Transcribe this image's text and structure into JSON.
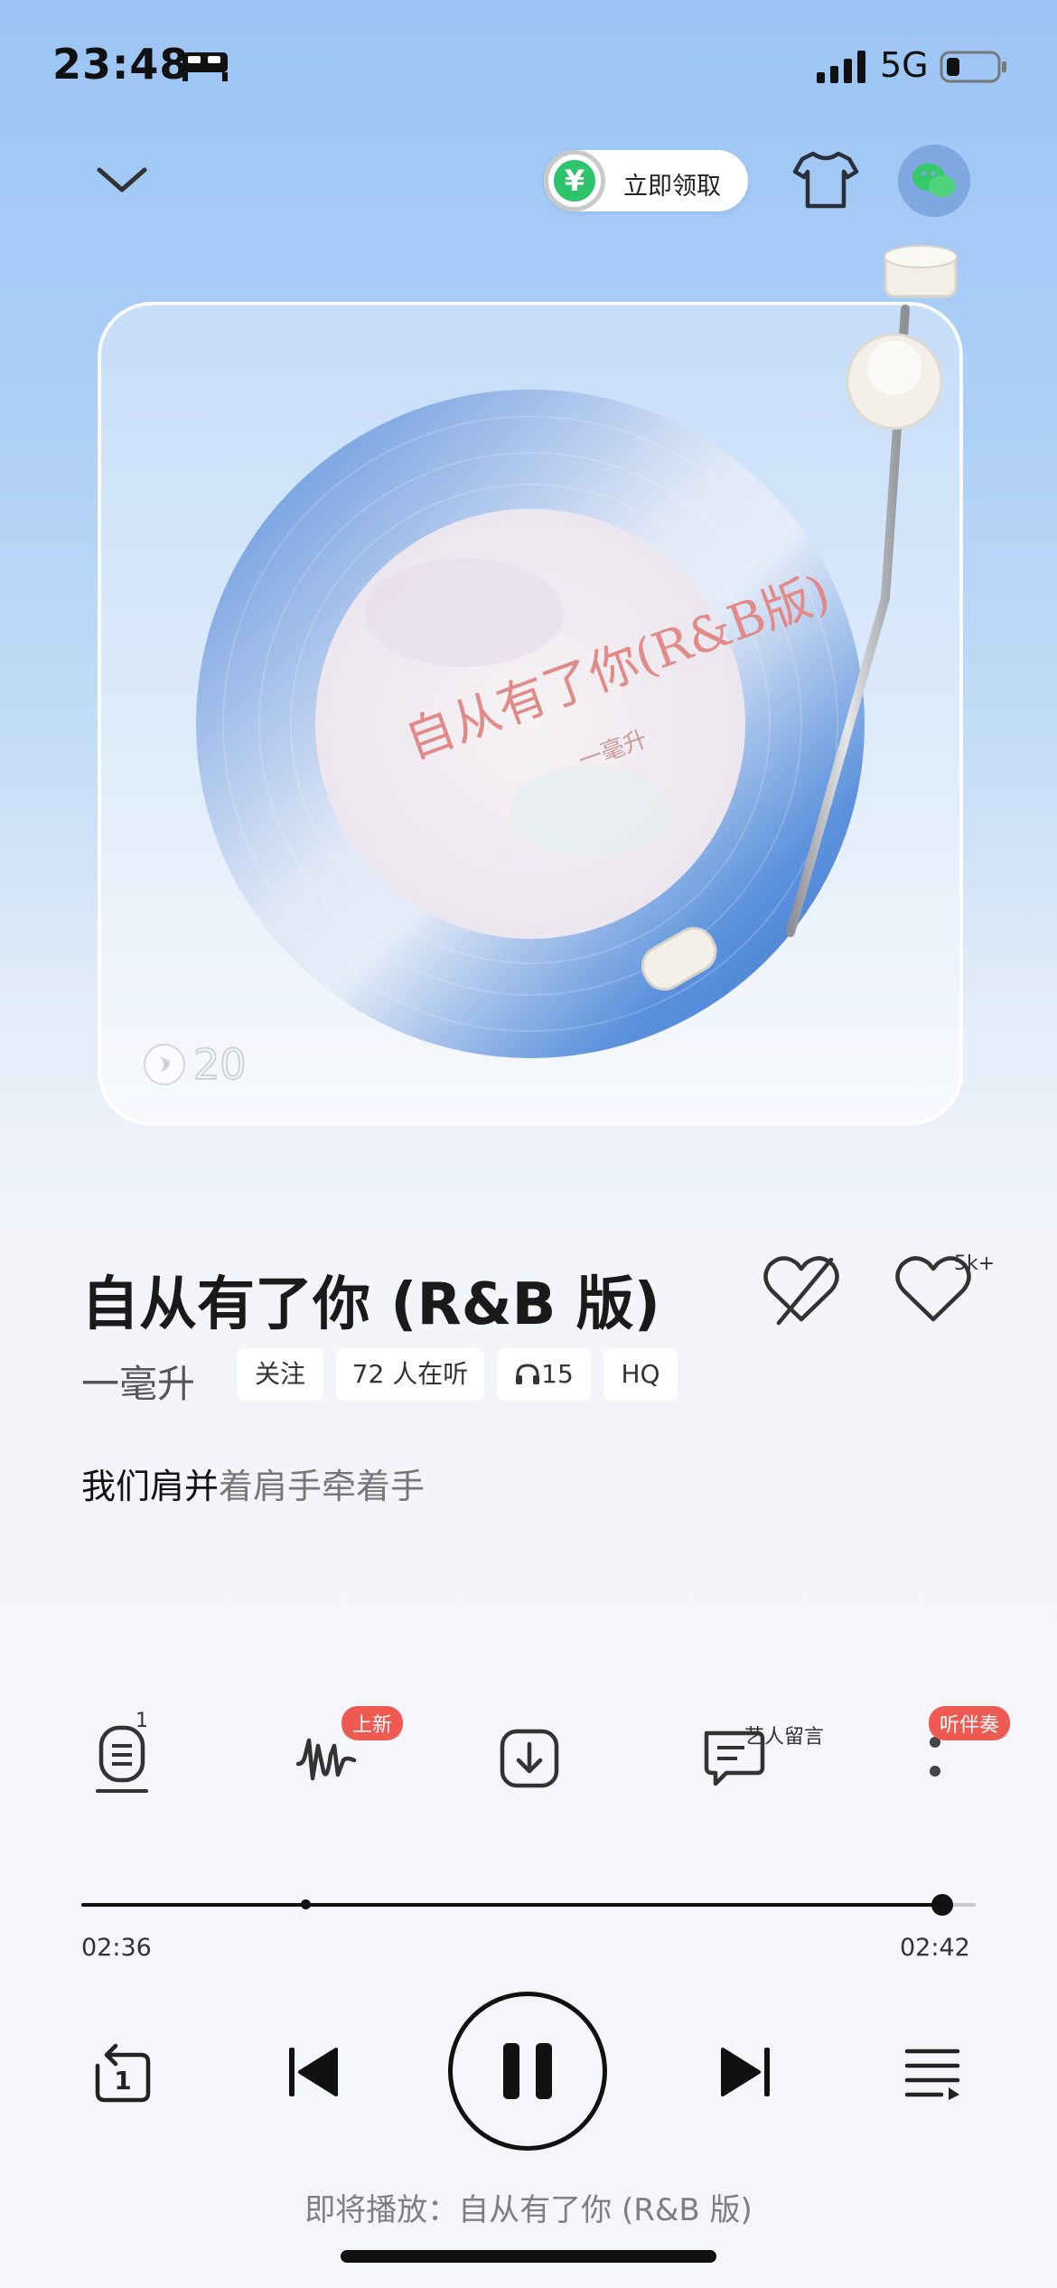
{
  "status_bar": {
    "time": "23:48",
    "network": "5G",
    "bed_icon": "bed-icon",
    "signal_icon": "signal-icon",
    "battery_icon": "battery-icon",
    "battery_level": 0.2
  },
  "top": {
    "claim_label": "立即领取",
    "coin_glyph": "¥",
    "collapse_icon": "chevron-down-icon",
    "theme_icon": "tshirt-icon",
    "share_icon": "wechat-icon"
  },
  "album_art": {
    "title_art": "自从有了你(R&B版)",
    "artist_art": "一毫升",
    "logo_text": "20"
  },
  "song": {
    "title": "自从有了你 (R&B 版)",
    "artist": "一毫升",
    "follow_label": "关注",
    "listeners_label": "72 人在听",
    "headphone_count": "15",
    "quality_label": "HQ",
    "like_count": "5k+"
  },
  "lyric": {
    "sung": "我们肩并",
    "unsung": "着肩手牵着手"
  },
  "functions": {
    "playlist_badge": "1",
    "sound_effect_badge": "上新",
    "comment_label": "艺人留言",
    "more_badge": "听伴奏"
  },
  "progress": {
    "current": "02:36",
    "total": "02:42",
    "ratio": 0.963,
    "marker_ratio": 0.25
  },
  "controls": {
    "repeat_count": "1"
  },
  "up_next": {
    "label": "即将播放：自从有了你 (R&B 版)"
  },
  "colors": {
    "accent_red": "#ee5a52",
    "green": "#2ec46b",
    "vinyl_blue": "#5a8fd8"
  }
}
